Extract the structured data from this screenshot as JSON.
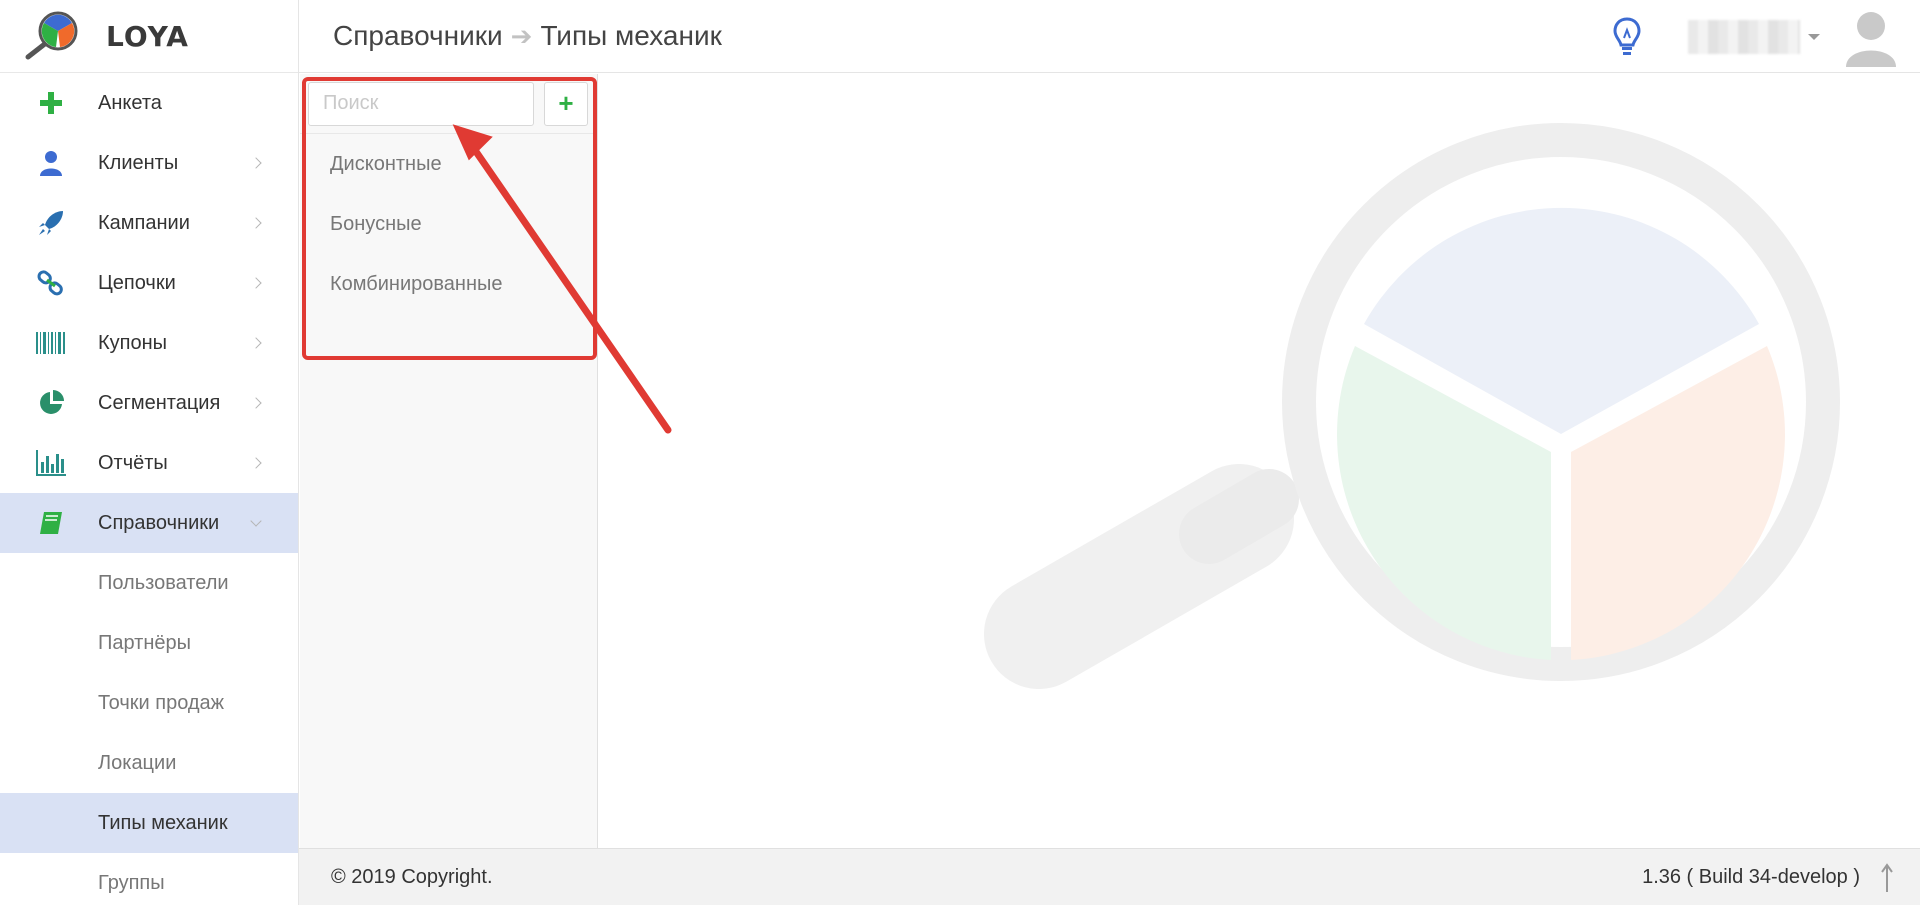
{
  "brand": {
    "name": "LOYA"
  },
  "sidebar": {
    "items": [
      {
        "label": "Анкета",
        "icon": "plus-icon",
        "has_children": false
      },
      {
        "label": "Клиенты",
        "icon": "user-icon",
        "has_children": true
      },
      {
        "label": "Кампании",
        "icon": "rocket-icon",
        "has_children": true
      },
      {
        "label": "Цепочки",
        "icon": "chain-link-icon",
        "has_children": true
      },
      {
        "label": "Купоны",
        "icon": "barcode-icon",
        "has_children": true
      },
      {
        "label": "Сегментация",
        "icon": "pie-chart-icon",
        "has_children": true
      },
      {
        "label": "Отчёты",
        "icon": "bar-chart-icon",
        "has_children": true
      },
      {
        "label": "Справочники",
        "icon": "book-icon",
        "has_children": true,
        "expanded": true,
        "active": true
      }
    ],
    "subitems": [
      {
        "label": "Пользователи"
      },
      {
        "label": "Партнёры"
      },
      {
        "label": "Точки продаж"
      },
      {
        "label": "Локации"
      },
      {
        "label": "Типы механик",
        "active": true
      },
      {
        "label": "Группы"
      }
    ]
  },
  "header": {
    "breadcrumb": [
      "Справочники",
      "Типы механик"
    ]
  },
  "list_panel": {
    "search_placeholder": "Поиск",
    "add_label": "+",
    "items": [
      "Дисконтные",
      "Бонусные",
      "Комбинированные"
    ]
  },
  "footer": {
    "copyright": "© 2019 Copyright.",
    "version": "1.36 ( Build 34-develop )"
  },
  "colors": {
    "accent_blue": "#3d6bd1",
    "active_bg": "#d9e1f4",
    "annotation_red": "#e03a33",
    "add_green": "#2fb044"
  }
}
